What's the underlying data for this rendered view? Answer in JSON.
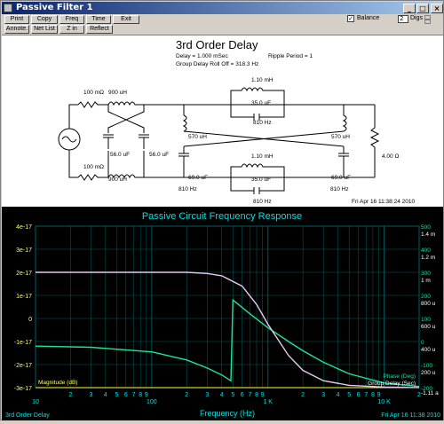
{
  "window": {
    "title": "Passive Filter 1"
  },
  "toolbar": {
    "row1": [
      "Print",
      "Copy",
      "Freq",
      "Time",
      "Exit"
    ],
    "row2": [
      "Annote.",
      "Net List",
      "Z in",
      "Reflect"
    ],
    "balance_label": "Balance",
    "balance_checked": "✓",
    "digs_value": "2",
    "digs_label": "Digs"
  },
  "schematic": {
    "title": "3rd Order Delay",
    "delay": "Delay = 1.000 mSec",
    "ripple": "Ripple Period = 1",
    "rolloff": "Group Delay Roll Off = 318.3 Hz",
    "r_top": "100 mΩ",
    "r_bot": "100 mΩ",
    "l_cross_top": "900 uH",
    "l_cross_bot": "900 uH",
    "c_left1": "56.0 uF",
    "c_left2": "56.0 uF",
    "l_top_series": "1.10 mH",
    "c_top_series": "35.0 uF",
    "f_top_series": "810 Hz",
    "l_bot_series": "1.10 mH",
    "c_bot_series": "35.0 uF",
    "f_bot_series": "810 Hz",
    "l_shunt_left": "570 uH",
    "l_shunt_right": "570 uH",
    "c_shunt_left": "69.0 uF",
    "c_shunt_right": "69.0 uF",
    "f_shunt_left": "810 Hz",
    "f_shunt_right": "810 Hz",
    "r_load": "4.00 Ω",
    "timestamp": "Fri Apr 16 11:38:24 2010"
  },
  "colors": {
    "magnitude": "#e8c8f0",
    "phase": "#20e0a0",
    "group_delay": "#ffffff",
    "title": "#00e0e0",
    "grid": "#006060"
  },
  "plot": {
    "title": "Passive Circuit Frequency Response",
    "left_ticks": [
      "4e-17",
      "3e-17",
      "2e-17",
      "1e-17",
      "0",
      "-1e-17",
      "-2e-17",
      "-3e-17"
    ],
    "right_phase_ticks": [
      "500",
      "400",
      "300",
      "200",
      "100",
      "0",
      "-100",
      "-200"
    ],
    "right_delay_ticks": [
      "1.4 m",
      "1.2 m",
      "1 m",
      "800 u",
      "600 u",
      "400 u",
      "200 u",
      "-1.11 a"
    ],
    "x_major": [
      "10",
      "100",
      "1 K",
      "10 K"
    ],
    "x_minor": [
      "2",
      "3",
      "4",
      "5",
      "6",
      "7",
      "8",
      "9"
    ],
    "xlabel": "Frequency (Hz)",
    "magnitude_label": "Magnitude (dB)",
    "phase_label": "Phase (Deg)",
    "delay_label": "Group Delay (Sec)",
    "bottom_left": "3rd Order Delay",
    "timestamp": "Fri Apr 16 11:38 2010"
  },
  "chart_data": {
    "type": "line",
    "title": "Passive Circuit Frequency Response",
    "xlabel": "Frequency (Hz)",
    "x_scale": "log",
    "xlim": [
      10,
      20000
    ],
    "series": [
      {
        "name": "Magnitude (dB)",
        "axis": "left",
        "ylim": [
          -3e-17,
          4e-17
        ],
        "x": [
          10,
          100,
          250,
          300,
          500,
          700,
          1000,
          1500,
          2000,
          3000,
          5000,
          20000
        ],
        "y": [
          -3e-17,
          -3e-17,
          -3e-17,
          -3e-17,
          -3e-17,
          -3e-17,
          -3e-17,
          -3e-17,
          -3e-17,
          -3e-17,
          -3e-17,
          -3e-17
        ]
      },
      {
        "name": "Phase (Deg)",
        "axis": "right",
        "ylim": [
          -200,
          500
        ],
        "x": [
          10,
          30,
          100,
          200,
          300,
          400,
          480,
          500,
          700,
          1000,
          1500,
          2000,
          3000,
          5000,
          10000,
          20000
        ],
        "y": [
          -20,
          -25,
          -45,
          -80,
          -115,
          -145,
          -170,
          180,
          120,
          60,
          0,
          -40,
          -90,
          -140,
          -180,
          -195
        ]
      },
      {
        "name": "Group Delay (Sec)",
        "axis": "right2",
        "ylim": [
          0,
          0.0014
        ],
        "x": [
          10,
          100,
          200,
          300,
          400,
          600,
          800,
          1000,
          1500,
          2000,
          3000,
          5000,
          10000,
          20000
        ],
        "y": [
          0.001,
          0.001,
          0.001,
          0.00099,
          0.00097,
          0.00088,
          0.00072,
          0.00055,
          0.00028,
          0.00015,
          6e-05,
          2e-05,
          5e-06,
          1e-06
        ]
      }
    ]
  }
}
